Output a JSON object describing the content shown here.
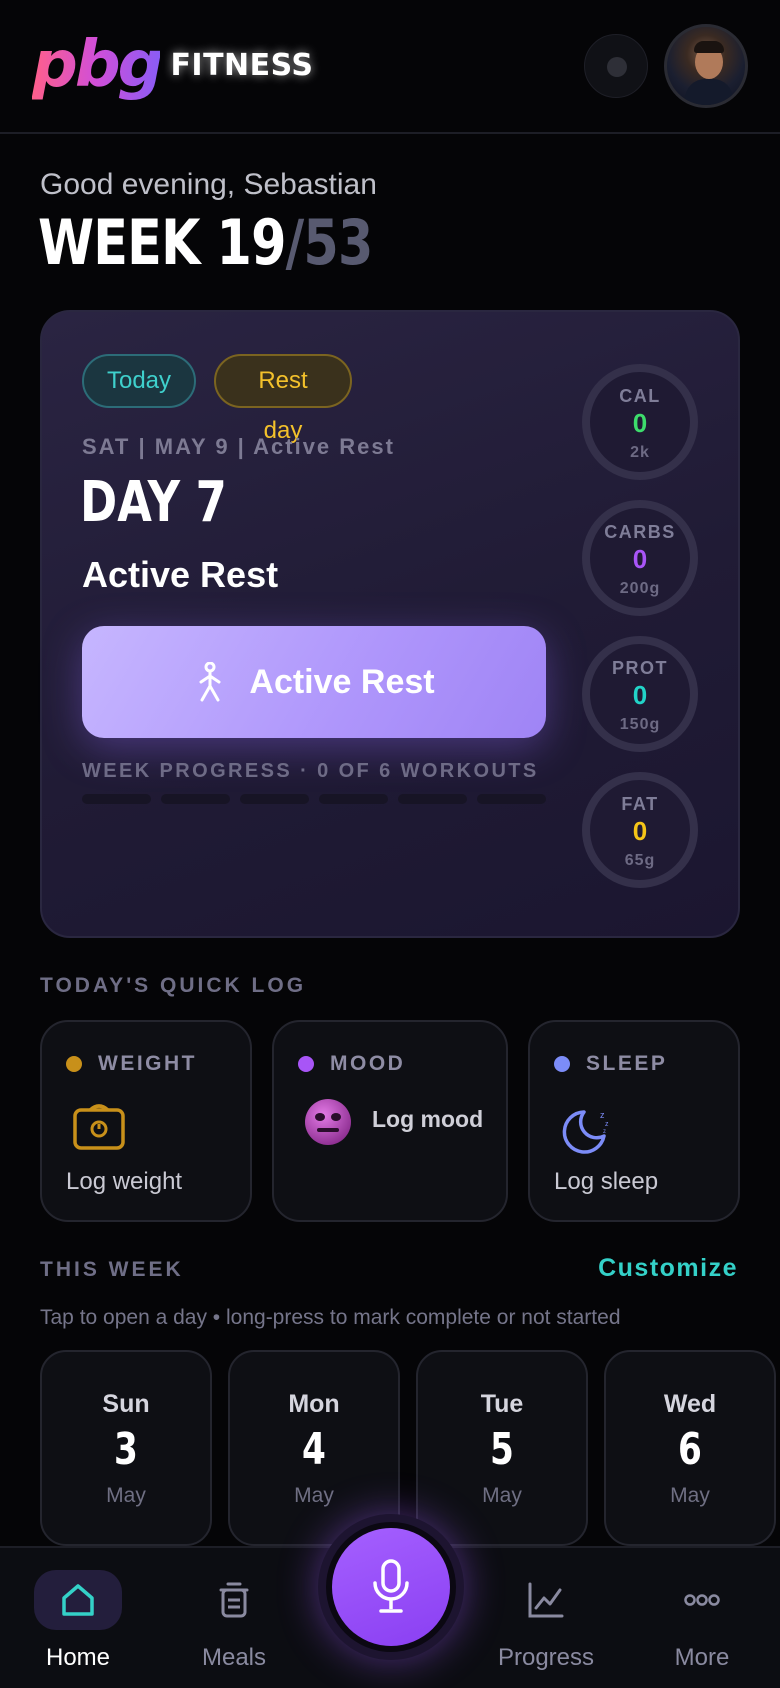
{
  "header": {
    "logo_mark": "pbg",
    "logo_word": "FITNESS"
  },
  "greeting": "Good evening, Sebastian",
  "week": {
    "label": "WEEK 19",
    "total": "/53"
  },
  "today_card": {
    "chips": {
      "today": "Today",
      "rest": "Rest day"
    },
    "date_line": "SAT | MAY 9 | Active Rest",
    "day": "DAY 7",
    "workout": "Active Rest",
    "cta_label": "Active Rest",
    "progress_label": "WEEK PROGRESS · 0 OF 6 WORKOUTS",
    "progress_completed": 0,
    "progress_total": 6,
    "macros": [
      {
        "label": "CAL",
        "value": "0",
        "goal": "2k",
        "color": "#3ddc6c"
      },
      {
        "label": "CARBS",
        "value": "0",
        "goal": "200g",
        "color": "#a855f7"
      },
      {
        "label": "PROT",
        "value": "0",
        "goal": "150g",
        "color": "#22d3c8"
      },
      {
        "label": "FAT",
        "value": "0",
        "goal": "65g",
        "color": "#f5c518"
      }
    ]
  },
  "quick_log": {
    "title": "TODAY'S QUICK LOG",
    "weight": {
      "title": "WEIGHT",
      "action": "Log weight",
      "dot": "#c8901a"
    },
    "mood": {
      "title": "MOOD",
      "action": "Log mood",
      "dot": "#a855f7"
    },
    "sleep": {
      "title": "SLEEP",
      "action": "Log sleep",
      "dot": "#7c8cf8"
    }
  },
  "this_week": {
    "title": "THIS WEEK",
    "customize": "Customize",
    "hint": "Tap to open a day • long-press to mark complete or not started",
    "days": [
      {
        "name": "Sun",
        "num": "3",
        "month": "May"
      },
      {
        "name": "Mon",
        "num": "4",
        "month": "May"
      },
      {
        "name": "Tue",
        "num": "5",
        "month": "May"
      },
      {
        "name": "Wed",
        "num": "6",
        "month": "May"
      }
    ]
  },
  "nav": {
    "home": "Home",
    "meals": "Meals",
    "progress": "Progress",
    "more": "More"
  },
  "colors": {
    "accent_purple": "#8a3ff2",
    "accent_teal": "#34d1c8",
    "rest_yellow": "#f3c12b"
  }
}
